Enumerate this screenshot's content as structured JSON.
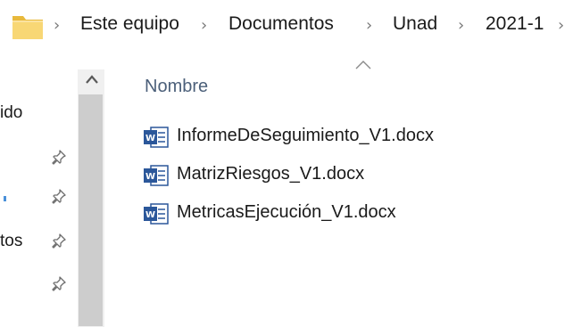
{
  "address_bar": {
    "crumbs": [
      "Este equipo",
      "Documentos",
      "Unad",
      "2021-1"
    ],
    "separator": "›"
  },
  "nav_pane": {
    "items": [
      {
        "label": "ido",
        "pinned": false
      },
      {
        "label": "",
        "pinned": true
      },
      {
        "label": "",
        "pinned": true
      },
      {
        "label": "tos",
        "pinned": true
      },
      {
        "label": "",
        "pinned": true
      }
    ]
  },
  "content": {
    "column_header": "Nombre",
    "sort_direction": "ascending",
    "files": [
      {
        "name": "InformeDeSeguimiento_V1.docx",
        "icon": "word-doc-icon"
      },
      {
        "name": "MatrizRiesgos_V1.docx",
        "icon": "word-doc-icon"
      },
      {
        "name": "MetricasEjecución_V1.docx",
        "icon": "word-doc-icon"
      }
    ]
  },
  "colors": {
    "folder_yellow": "#f8d775",
    "word_blue": "#2b579a",
    "header_text": "#4c607a",
    "scrollbar_track": "#f0f0f0",
    "scrollbar_thumb": "#cdcdcd"
  }
}
